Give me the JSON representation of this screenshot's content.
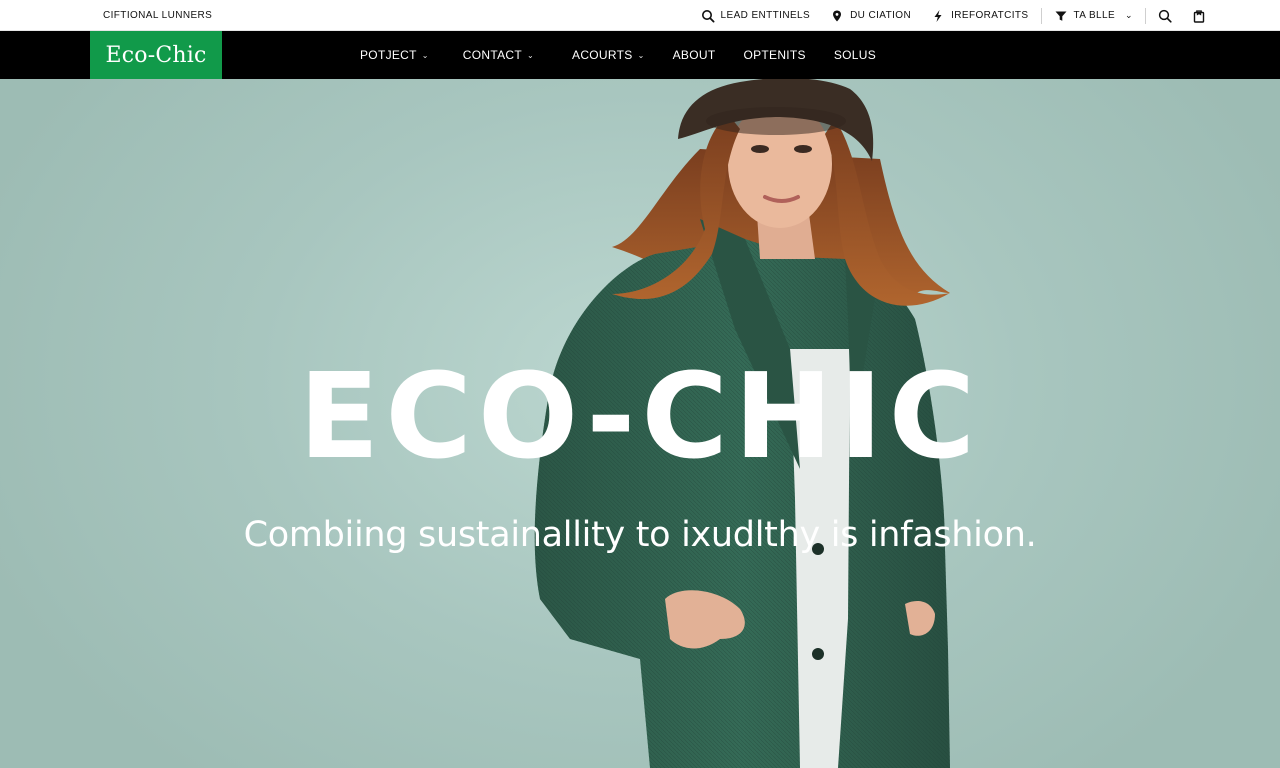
{
  "utility_bar": {
    "left_label": "CIFTIONAL LUNNERS",
    "links": [
      {
        "label": "LEAD ENTTINELS",
        "icon": "search-icon"
      },
      {
        "label": "DU CIATION",
        "icon": "location-pin-icon"
      },
      {
        "label": "IREFORATCITS",
        "icon": "bolt-icon"
      },
      {
        "label": "TA BLLE",
        "icon": "filter-icon"
      }
    ],
    "search_icon": "search-icon",
    "bag_icon": "shopping-bag-icon"
  },
  "nav": {
    "logo": "Eco-Chic",
    "items": [
      {
        "label": "POTJECT",
        "has_dropdown": true
      },
      {
        "label": "CONTACT",
        "has_dropdown": true
      },
      {
        "label": "ACOURTS",
        "has_dropdown": true
      },
      {
        "label": "ABOUT",
        "has_dropdown": false
      },
      {
        "label": "OPTENITS",
        "has_dropdown": false
      },
      {
        "label": "SOLUS",
        "has_dropdown": false
      }
    ]
  },
  "hero": {
    "title": "ECO-CHIC",
    "subtitle": "Combiing sustainallity to ixudlthy is infashion."
  },
  "colors": {
    "brand_green": "#119a4a",
    "nav_bg": "#000000",
    "hero_bg": "#a9c7bf",
    "coat_green": "#2e5e4c"
  }
}
